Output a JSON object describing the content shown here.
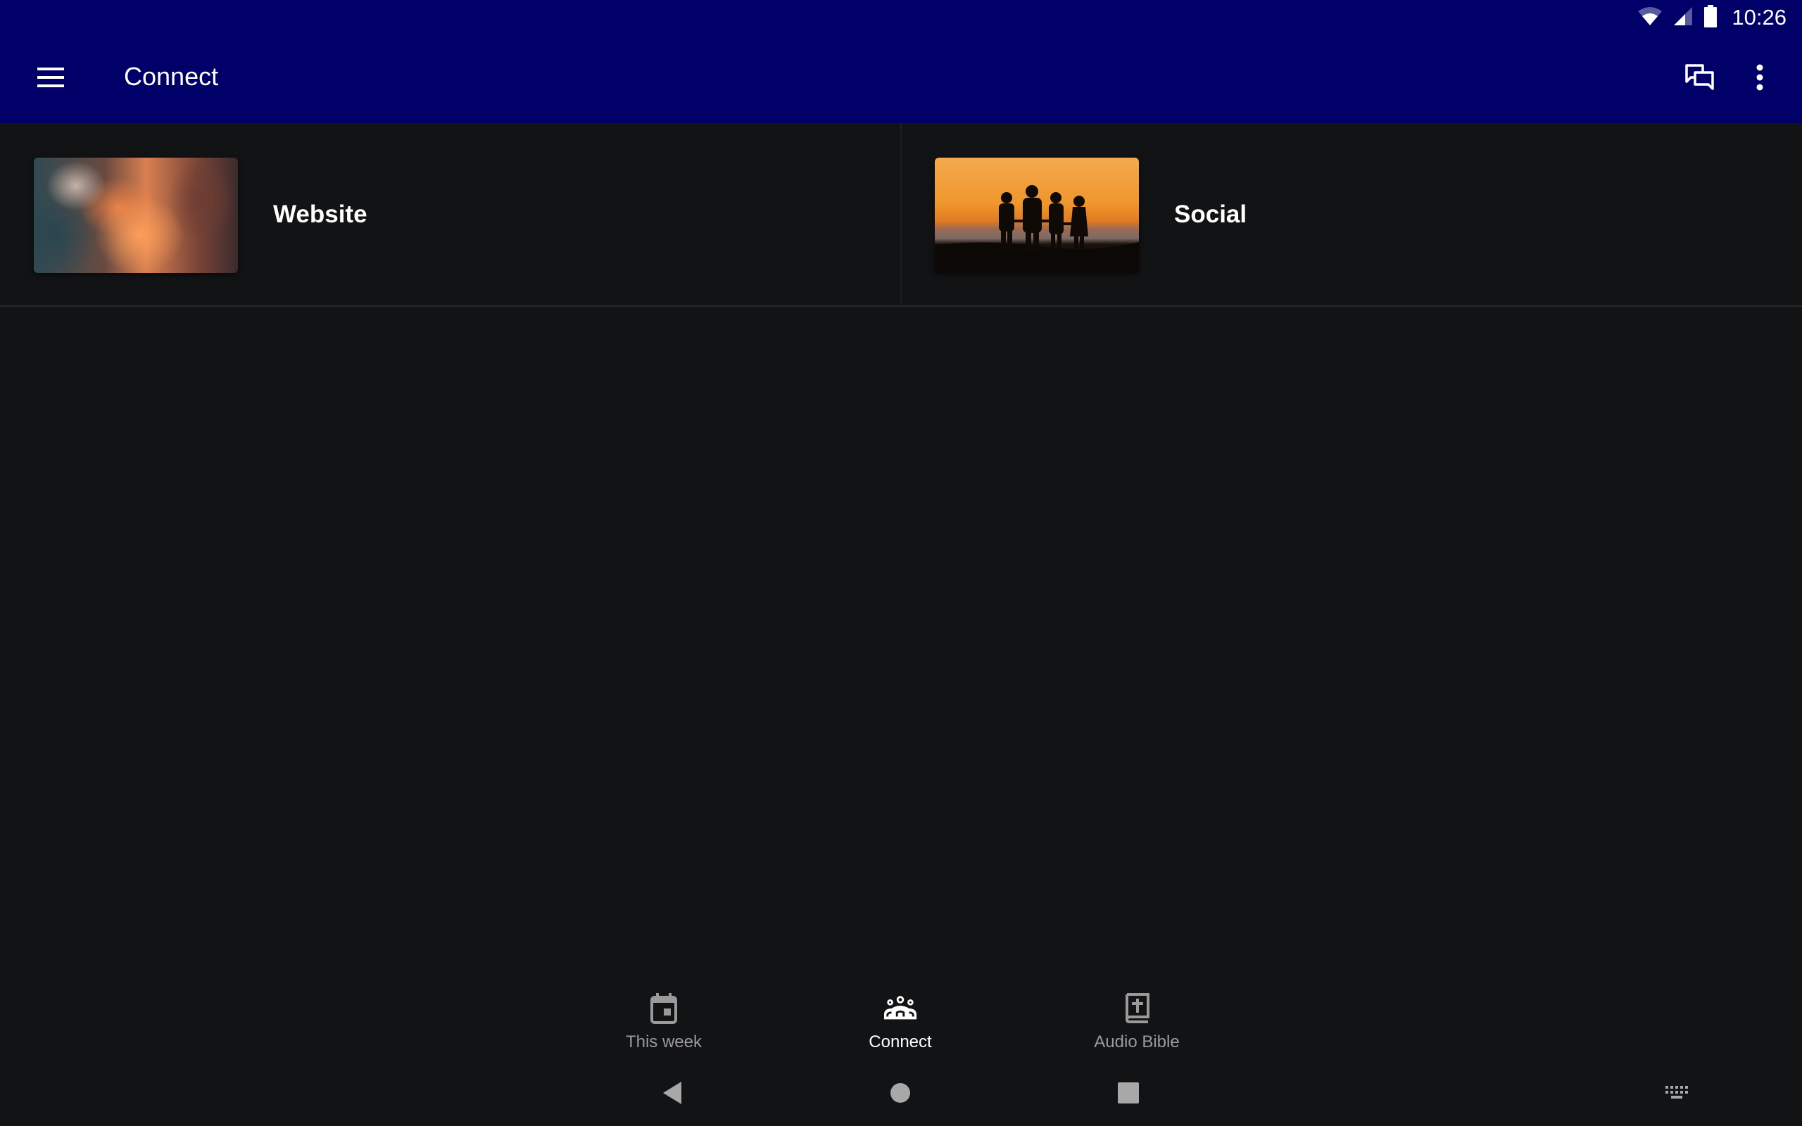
{
  "status_bar": {
    "time": "10:26",
    "icons": [
      "wifi-icon",
      "cellular-signal-icon",
      "battery-icon"
    ]
  },
  "app_bar": {
    "title": "Connect",
    "menu_icon": "hamburger-menu-icon",
    "actions": [
      {
        "name": "chat",
        "icon": "chat-bubbles-icon"
      },
      {
        "name": "more",
        "icon": "more-vertical-icon"
      }
    ]
  },
  "cards": [
    {
      "label": "Website",
      "image": "sunset-clouds"
    },
    {
      "label": "Social",
      "image": "family-silhouette-sunset"
    }
  ],
  "bottom_nav": {
    "items": [
      {
        "label": "This week",
        "icon": "calendar-icon",
        "active": false
      },
      {
        "label": "Connect",
        "icon": "groups-icon",
        "active": true
      },
      {
        "label": "Audio Bible",
        "icon": "bible-book-icon",
        "active": false
      }
    ]
  },
  "system_nav": {
    "buttons": [
      "back",
      "home",
      "recents",
      "keyboard"
    ]
  },
  "colors": {
    "app_bar": "#000068",
    "background": "#121315",
    "inactive": "#9a9a9a",
    "active": "#ffffff"
  }
}
